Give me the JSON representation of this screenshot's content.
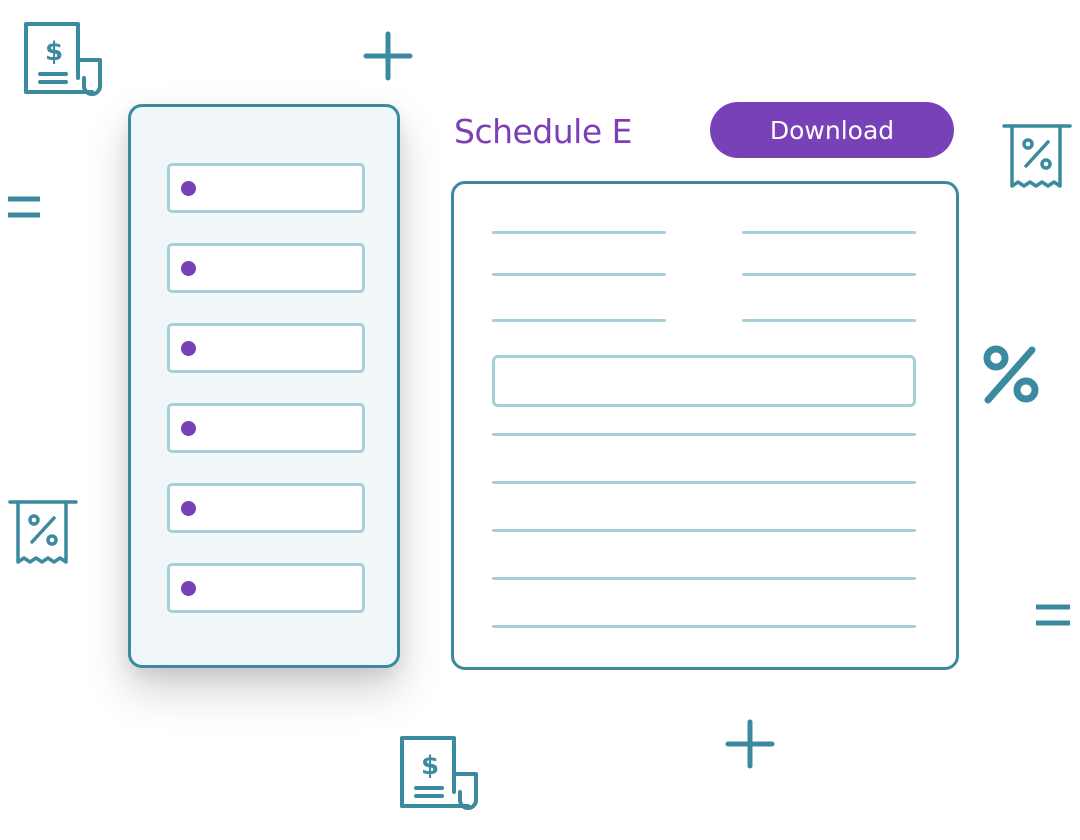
{
  "header": {
    "title": "Schedule E",
    "download_label": "Download"
  },
  "form": {
    "fields": [
      {
        "label": ""
      },
      {
        "label": ""
      },
      {
        "label": ""
      },
      {
        "label": ""
      },
      {
        "label": ""
      },
      {
        "label": ""
      }
    ]
  },
  "decorations": {
    "percent_symbol": "%",
    "icons": [
      "dollar-receipt-icon",
      "percent-receipt-icon",
      "plus-icon",
      "equals-icon"
    ]
  },
  "colors": {
    "accent_purple": "#7841b8",
    "teal": "#3b8aa0",
    "light_teal": "#a7cfd8",
    "panel_bg": "#f1f6f8"
  }
}
